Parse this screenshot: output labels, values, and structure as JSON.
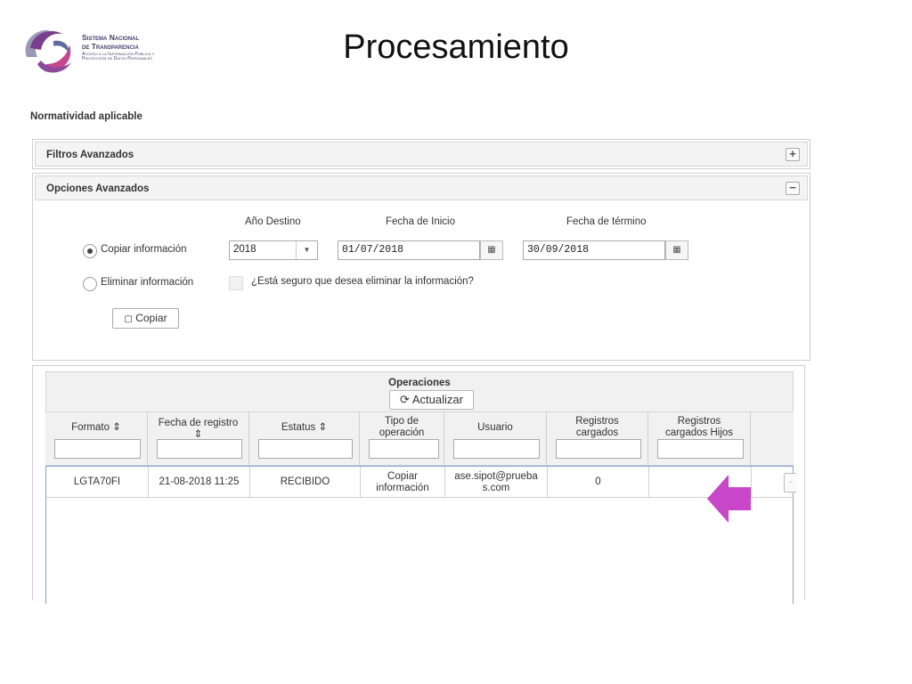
{
  "slide": {
    "title": "Procesamiento"
  },
  "logo": {
    "line1": "Sistema Nacional",
    "line2": "de Transparencia",
    "line3": "Acceso a la Información Pública y Protección de Datos Personales"
  },
  "section_label": "Normatividad aplicable",
  "filtros": {
    "title": "Filtros Avanzados",
    "toggle": "+"
  },
  "opciones": {
    "title": "Opciones Avanzados",
    "toggle": "−",
    "labels": {
      "anio_destino": "Año Destino",
      "fecha_inicio": "Fecha de Inicio",
      "fecha_termino": "Fecha de término"
    },
    "copiar_radio_label": "Copiar información",
    "eliminar_radio_label": "Eliminar información",
    "copiar_selected": true,
    "anio_value": "2018",
    "fecha_inicio_value": "01/07/2018",
    "fecha_termino_value": "30/09/2018",
    "confirm_label": "¿Está seguro que desea eliminar la información?",
    "copiar_button": "Copiar"
  },
  "operaciones": {
    "title": "Operaciones",
    "refresh_button": "Actualizar",
    "columns": [
      {
        "line1": "Formato",
        "line2": "",
        "sort": "⇕"
      },
      {
        "line1": "Fecha de registro",
        "line2": "",
        "sort": "⇕"
      },
      {
        "line1": "Estatus",
        "line2": "",
        "sort": "⇕"
      },
      {
        "line1": "Tipo de",
        "line2": "operación",
        "sort": ""
      },
      {
        "line1": "Usuario",
        "line2": "",
        "sort": ""
      },
      {
        "line1": "Registros",
        "line2": "cargados",
        "sort": ""
      },
      {
        "line1": "Registros",
        "line2": "cargados Hijos",
        "sort": ""
      }
    ],
    "rows": [
      {
        "formato": "LGTA70FI",
        "fecha_registro": "21-08-2018 11:25",
        "estatus": "RECIBIDO",
        "tipo_l1": "Copiar",
        "tipo_l2": "información",
        "usuario_l1": "ase.sipot@prueba",
        "usuario_l2": "s.com",
        "registros": "0",
        "registros_hijos": ""
      }
    ]
  },
  "colors": {
    "arrow": "#c846c8",
    "row_border": "#7fa6d6",
    "logo_purple": "#7a3f8c",
    "logo_pink": "#c6478e"
  }
}
